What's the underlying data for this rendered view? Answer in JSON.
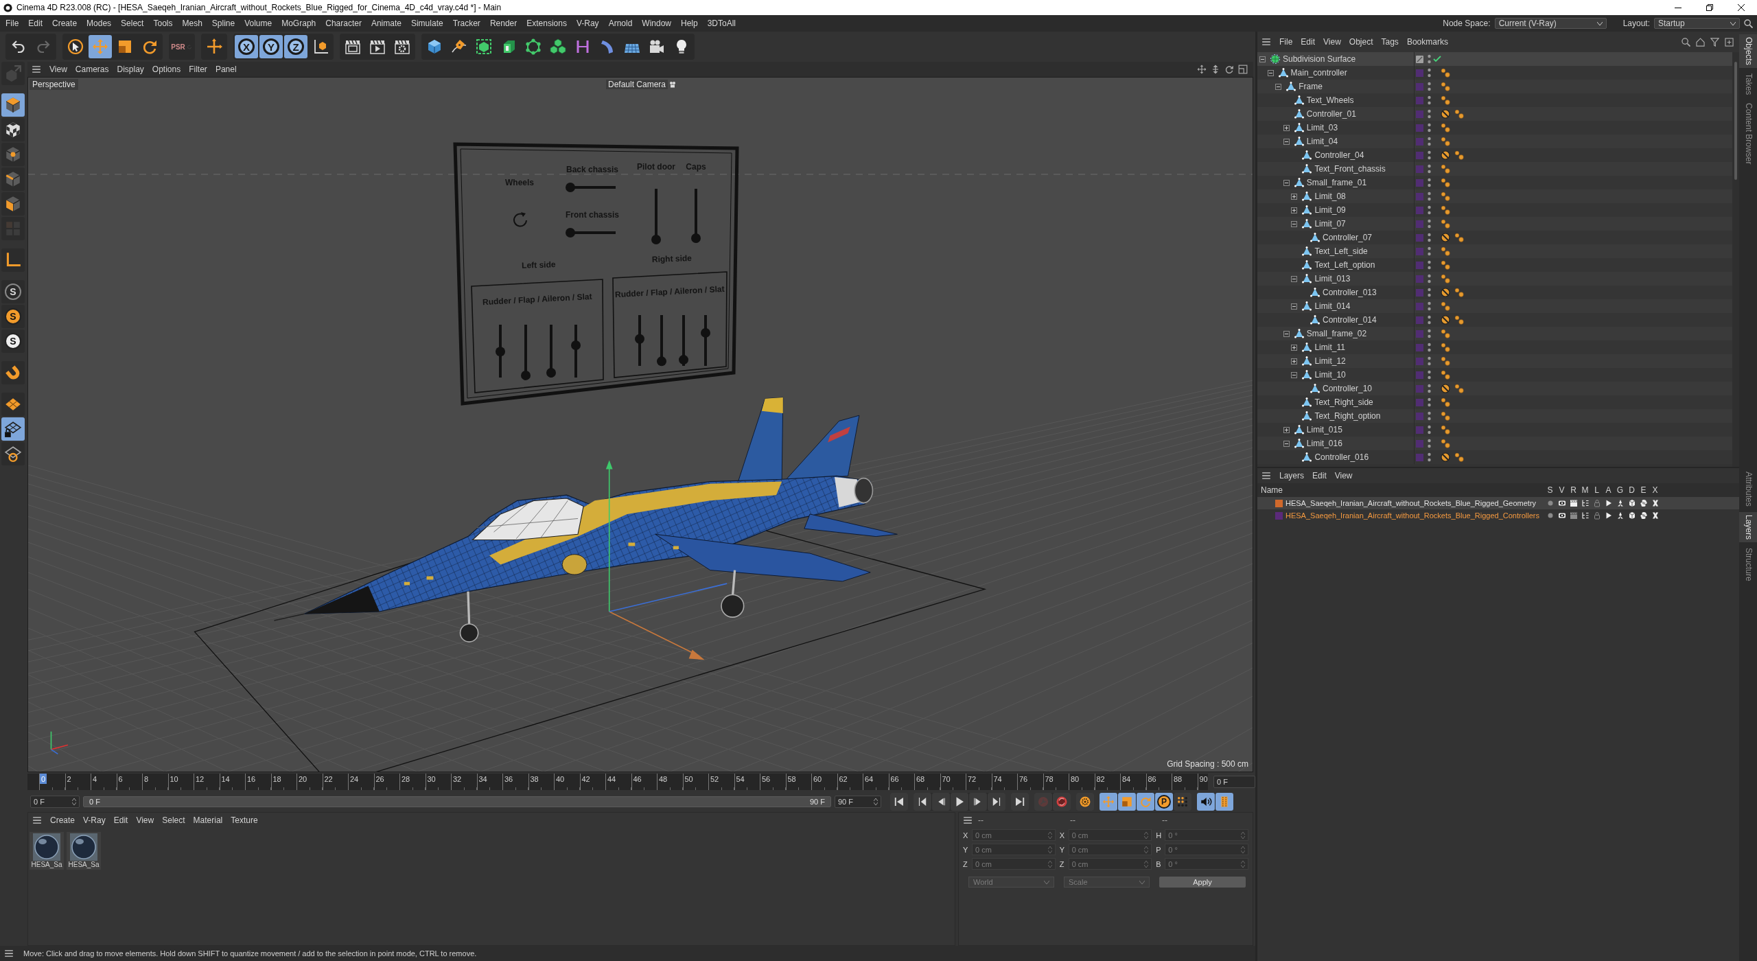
{
  "window": {
    "title": "Cinema 4D R23.008 (RC) - [HESA_Saeqeh_Iranian_Aircraft_without_Rockets_Blue_Rigged_for_Cinema_4D_c4d_vray.c4d *] - Main"
  },
  "menu_bar": {
    "items": [
      "File",
      "Edit",
      "Create",
      "Modes",
      "Select",
      "Tools",
      "Mesh",
      "Spline",
      "Volume",
      "MoGraph",
      "Character",
      "Animate",
      "Simulate",
      "Tracker",
      "Render",
      "Extensions",
      "V-Ray",
      "Arnold",
      "Window",
      "Help",
      "3DToAll"
    ],
    "node_space": {
      "label": "Node Space:",
      "value": "Current (V-Ray)"
    },
    "layout": {
      "label": "Layout:",
      "value": "Startup"
    }
  },
  "toolbar": {
    "groups": [
      [
        {
          "kind": "undo",
          "selected": false,
          "disabled": false
        },
        {
          "kind": "redo",
          "selected": false,
          "disabled": true
        }
      ],
      [
        {
          "kind": "select",
          "selected": false,
          "disabled": false
        },
        {
          "kind": "move",
          "selected": true,
          "disabled": false
        },
        {
          "kind": "scale",
          "selected": false,
          "disabled": false
        },
        {
          "kind": "rotate",
          "selected": false,
          "disabled": false
        }
      ],
      [
        {
          "kind": "psr",
          "label": "PSR",
          "selected": false,
          "disabled": true
        }
      ],
      [
        {
          "kind": "add",
          "selected": false,
          "disabled": false
        }
      ],
      [
        {
          "kind": "axis",
          "label": "X",
          "selected": true,
          "disabled": false
        },
        {
          "kind": "axis",
          "label": "Y",
          "selected": true,
          "disabled": false
        },
        {
          "kind": "axis",
          "label": "Z",
          "selected": true,
          "disabled": false
        },
        {
          "kind": "coords",
          "selected": false,
          "disabled": false
        }
      ],
      [
        {
          "kind": "render-view",
          "selected": false,
          "disabled": false
        },
        {
          "kind": "render",
          "selected": false,
          "disabled": false
        },
        {
          "kind": "render-settings",
          "selected": false,
          "disabled": false
        }
      ],
      [
        {
          "kind": "cube",
          "selected": false,
          "disabled": false
        },
        {
          "kind": "pen",
          "selected": false,
          "disabled": false
        },
        {
          "kind": "subdivision",
          "selected": false,
          "disabled": false
        },
        {
          "kind": "extrude",
          "selected": false,
          "disabled": false
        },
        {
          "kind": "polyhedron",
          "selected": false,
          "disabled": false
        },
        {
          "kind": "cloner",
          "selected": false,
          "disabled": false
        },
        {
          "kind": "symmetry",
          "selected": false,
          "disabled": false
        },
        {
          "kind": "deformer",
          "selected": false,
          "disabled": false
        },
        {
          "kind": "floor",
          "selected": false,
          "disabled": false
        },
        {
          "kind": "camera",
          "selected": false,
          "disabled": false
        },
        {
          "kind": "light",
          "selected": false,
          "disabled": false
        }
      ]
    ]
  },
  "left_toolbar": {
    "groups": [
      [
        {
          "kind": "make-editable",
          "selected": false,
          "disabled": true
        }
      ],
      [
        {
          "kind": "model",
          "selected": true,
          "disabled": false
        },
        {
          "kind": "texture",
          "selected": false,
          "disabled": false
        },
        {
          "kind": "point",
          "selected": false,
          "disabled": false
        },
        {
          "kind": "edge",
          "selected": false,
          "disabled": false
        },
        {
          "kind": "polygon",
          "selected": false,
          "disabled": false
        },
        {
          "kind": "uv",
          "selected": false,
          "disabled": true
        }
      ],
      [
        {
          "kind": "axis-mode",
          "selected": false,
          "disabled": false
        }
      ],
      [
        {
          "kind": "solo-off",
          "label": "S",
          "selected": false,
          "disabled": false
        },
        {
          "kind": "solo-single",
          "label": "S",
          "selected": false,
          "disabled": false
        },
        {
          "kind": "solo-hierarchy",
          "label": "S",
          "selected": false,
          "disabled": false
        }
      ],
      [
        {
          "kind": "magnet",
          "selected": false,
          "disabled": false
        }
      ],
      [
        {
          "kind": "workplane",
          "selected": false,
          "disabled": false
        },
        {
          "kind": "grid-lock",
          "selected": true,
          "disabled": false
        },
        {
          "kind": "grid-snap",
          "selected": false,
          "disabled": false
        }
      ]
    ]
  },
  "viewport": {
    "menu": [
      "View",
      "Cameras",
      "Display",
      "Options",
      "Filter",
      "Panel"
    ],
    "view_name": "Perspective",
    "camera": "Default Camera",
    "grid_spacing": "Grid Spacing : 500 cm",
    "board": {
      "wheels": "Wheels",
      "horizontal_sliders": [
        {
          "label": "Back chassis",
          "level": 0
        },
        {
          "label": "Front chassis",
          "level": 0
        }
      ],
      "vertical_sliders": [
        {
          "label": "Pilot door",
          "level": 0
        },
        {
          "label": "Caps",
          "level": 0
        }
      ],
      "sides": [
        {
          "label": "Left side",
          "group_title": "Rudder / Flap / Aileron / Slat",
          "sliders": [
            {
              "level": 0.49
            },
            {
              "level": 0.04
            },
            {
              "level": 0.09
            },
            {
              "level": 0.61
            }
          ]
        },
        {
          "label": "Right side",
          "group_title": "Rudder / Flap / Aileron / Slat",
          "sliders": [
            {
              "level": 0.53
            },
            {
              "level": 0.09
            },
            {
              "level": 0.12
            },
            {
              "level": 0.65
            }
          ]
        }
      ]
    }
  },
  "timeline": {
    "ticks": [
      {
        "label": "0",
        "selected": true
      },
      {
        "label": "2",
        "selected": false
      },
      {
        "label": "4",
        "selected": false
      },
      {
        "label": "6",
        "selected": false
      },
      {
        "label": "8",
        "selected": false
      },
      {
        "label": "10",
        "selected": false
      },
      {
        "label": "12",
        "selected": false
      },
      {
        "label": "14",
        "selected": false
      },
      {
        "label": "16",
        "selected": false
      },
      {
        "label": "18",
        "selected": false
      },
      {
        "label": "20",
        "selected": false
      },
      {
        "label": "22",
        "selected": false
      },
      {
        "label": "24",
        "selected": false
      },
      {
        "label": "26",
        "selected": false
      },
      {
        "label": "28",
        "selected": false
      },
      {
        "label": "30",
        "selected": false
      },
      {
        "label": "32",
        "selected": false
      },
      {
        "label": "34",
        "selected": false
      },
      {
        "label": "36",
        "selected": false
      },
      {
        "label": "38",
        "selected": false
      },
      {
        "label": "40",
        "selected": false
      },
      {
        "label": "42",
        "selected": false
      },
      {
        "label": "44",
        "selected": false
      },
      {
        "label": "46",
        "selected": false
      },
      {
        "label": "48",
        "selected": false
      },
      {
        "label": "50",
        "selected": false
      },
      {
        "label": "52",
        "selected": false
      },
      {
        "label": "54",
        "selected": false
      },
      {
        "label": "56",
        "selected": false
      },
      {
        "label": "58",
        "selected": false
      },
      {
        "label": "60",
        "selected": false
      },
      {
        "label": "62",
        "selected": false
      },
      {
        "label": "64",
        "selected": false
      },
      {
        "label": "66",
        "selected": false
      },
      {
        "label": "68",
        "selected": false
      },
      {
        "label": "70",
        "selected": false
      },
      {
        "label": "72",
        "selected": false
      },
      {
        "label": "74",
        "selected": false
      },
      {
        "label": "76",
        "selected": false
      },
      {
        "label": "78",
        "selected": false
      },
      {
        "label": "80",
        "selected": false
      },
      {
        "label": "82",
        "selected": false
      },
      {
        "label": "84",
        "selected": false
      },
      {
        "label": "86",
        "selected": false
      },
      {
        "label": "88",
        "selected": false
      },
      {
        "label": "90",
        "selected": false
      }
    ],
    "current_frame": "0 F"
  },
  "transport": {
    "start": "0 F",
    "range": {
      "start": "0 F",
      "end": "90 F",
      "level": 1
    },
    "end": "90 F",
    "groups": [
      [
        {
          "kind": "first",
          "selected": false,
          "disabled": false
        }
      ],
      [
        {
          "kind": "prev-key",
          "selected": false,
          "disabled": false
        },
        {
          "kind": "prev-frame",
          "selected": false,
          "disabled": false
        },
        {
          "kind": "play",
          "selected": false,
          "disabled": false
        },
        {
          "kind": "next-frame",
          "selected": false,
          "disabled": false
        },
        {
          "kind": "next-key",
          "selected": false,
          "disabled": false
        }
      ],
      [
        {
          "kind": "last",
          "selected": false,
          "disabled": false
        }
      ],
      [
        {
          "kind": "record",
          "selected": false,
          "disabled": true
        },
        {
          "kind": "autokey",
          "selected": false,
          "disabled": false
        }
      ],
      [
        {
          "kind": "key",
          "selected": false,
          "disabled": false
        }
      ],
      [
        {
          "kind": "key-move",
          "selected": true,
          "disabled": false
        },
        {
          "kind": "key-scale",
          "selected": true,
          "disabled": false
        },
        {
          "kind": "key-rotate",
          "selected": true,
          "disabled": false
        },
        {
          "kind": "key-param",
          "label": "P",
          "selected": true,
          "disabled": false
        },
        {
          "kind": "key-pla",
          "selected": false,
          "disabled": false
        }
      ],
      [
        {
          "kind": "sound",
          "selected": true,
          "disabled": false
        },
        {
          "kind": "film",
          "selected": true,
          "disabled": false
        }
      ]
    ]
  },
  "materials": {
    "menu": [
      "Create",
      "V-Ray",
      "Edit",
      "View",
      "Select",
      "Material",
      "Texture"
    ],
    "items": [
      {
        "label": "HESA_Sa"
      },
      {
        "label": "HESA_Sa"
      }
    ]
  },
  "coordinates": {
    "headers": [
      "--",
      "--",
      "--"
    ],
    "rows": [
      [
        {
          "axis": "X",
          "value": "0 cm",
          "disabled": true
        },
        {
          "axis": "X",
          "value": "0 cm",
          "disabled": true
        },
        {
          "axis": "H",
          "value": "0 °",
          "disabled": true
        }
      ],
      [
        {
          "axis": "Y",
          "value": "0 cm",
          "disabled": true
        },
        {
          "axis": "Y",
          "value": "0 cm",
          "disabled": true
        },
        {
          "axis": "P",
          "value": "0 °",
          "disabled": true
        }
      ],
      [
        {
          "axis": "Z",
          "value": "0 cm",
          "disabled": true
        },
        {
          "axis": "Z",
          "value": "0 cm",
          "disabled": true
        },
        {
          "axis": "B",
          "value": "0 °",
          "disabled": true
        }
      ]
    ],
    "dropdowns": [
      {
        "value": "World",
        "disabled": true
      },
      {
        "value": "Scale",
        "disabled": true
      }
    ],
    "apply": "Apply"
  },
  "status_bar": {
    "text": "Move: Click and drag to move elements. Hold down SHIFT to quantize movement / add to the selection in point mode, CTRL to remove."
  },
  "objects": {
    "menu": [
      "File",
      "Edit",
      "View",
      "Object",
      "Tags",
      "Bookmarks"
    ],
    "items": [
      {
        "name": "Subdivision Surface",
        "kind": "generator",
        "expanded": true,
        "enabled": true,
        "children": [
          {
            "name": "Main_controller",
            "kind": "object",
            "expanded": true,
            "tags": [
              {
                "kind": "constraint"
              }
            ],
            "children": [
              {
                "name": "Frame",
                "kind": "object",
                "expanded": true,
                "tags": [
                  {
                    "kind": "constraint"
                  }
                ],
                "children": [
                  {
                    "name": "Text_Wheels",
                    "kind": "object",
                    "tags": [
                      {
                        "kind": "constraint"
                      }
                    ]
                  },
                  {
                    "name": "Controller_01",
                    "kind": "object",
                    "tags": [
                      {
                        "kind": "protection"
                      },
                      {
                        "kind": "constraint"
                      }
                    ]
                  },
                  {
                    "name": "Limit_03",
                    "kind": "object",
                    "expanded": false,
                    "tags": [
                      {
                        "kind": "constraint"
                      }
                    ]
                  },
                  {
                    "name": "Limit_04",
                    "kind": "object",
                    "expanded": true,
                    "tags": [
                      {
                        "kind": "constraint"
                      }
                    ],
                    "children": [
                      {
                        "name": "Controller_04",
                        "kind": "object",
                        "tags": [
                          {
                            "kind": "protection"
                          },
                          {
                            "kind": "constraint"
                          }
                        ]
                      },
                      {
                        "name": "Text_Front_chassis",
                        "kind": "object",
                        "tags": [
                          {
                            "kind": "constraint"
                          }
                        ]
                      }
                    ]
                  },
                  {
                    "name": "Small_frame_01",
                    "kind": "object",
                    "expanded": true,
                    "tags": [
                      {
                        "kind": "constraint"
                      }
                    ],
                    "children": [
                      {
                        "name": "Limit_08",
                        "kind": "object",
                        "expanded": false,
                        "tags": [
                          {
                            "kind": "constraint"
                          }
                        ]
                      },
                      {
                        "name": "Limit_09",
                        "kind": "object",
                        "expanded": false,
                        "tags": [
                          {
                            "kind": "constraint"
                          }
                        ]
                      },
                      {
                        "name": "Limit_07",
                        "kind": "object",
                        "expanded": true,
                        "tags": [
                          {
                            "kind": "constraint"
                          }
                        ],
                        "children": [
                          {
                            "name": "Controller_07",
                            "kind": "object",
                            "tags": [
                              {
                                "kind": "protection"
                              },
                              {
                                "kind": "constraint"
                              }
                            ]
                          }
                        ]
                      },
                      {
                        "name": "Text_Left_side",
                        "kind": "object",
                        "tags": [
                          {
                            "kind": "constraint"
                          }
                        ]
                      },
                      {
                        "name": "Text_Left_option",
                        "kind": "object",
                        "tags": [
                          {
                            "kind": "constraint"
                          }
                        ]
                      },
                      {
                        "name": "Limit_013",
                        "kind": "object",
                        "expanded": true,
                        "tags": [
                          {
                            "kind": "constraint"
                          }
                        ],
                        "children": [
                          {
                            "name": "Controller_013",
                            "kind": "object",
                            "tags": [
                              {
                                "kind": "protection"
                              },
                              {
                                "kind": "constraint"
                              }
                            ]
                          }
                        ]
                      },
                      {
                        "name": "Limit_014",
                        "kind": "object",
                        "expanded": true,
                        "tags": [
                          {
                            "kind": "constraint"
                          }
                        ],
                        "children": [
                          {
                            "name": "Controller_014",
                            "kind": "object",
                            "tags": [
                              {
                                "kind": "protection"
                              },
                              {
                                "kind": "constraint"
                              }
                            ]
                          }
                        ]
                      }
                    ]
                  },
                  {
                    "name": "Small_frame_02",
                    "kind": "object",
                    "expanded": true,
                    "tags": [
                      {
                        "kind": "constraint"
                      }
                    ],
                    "children": [
                      {
                        "name": "Limit_11",
                        "kind": "object",
                        "expanded": false,
                        "tags": [
                          {
                            "kind": "constraint"
                          }
                        ]
                      },
                      {
                        "name": "Limit_12",
                        "kind": "object",
                        "expanded": false,
                        "tags": [
                          {
                            "kind": "constraint"
                          }
                        ]
                      },
                      {
                        "name": "Limit_10",
                        "kind": "object",
                        "expanded": true,
                        "tags": [
                          {
                            "kind": "constraint"
                          }
                        ],
                        "children": [
                          {
                            "name": "Controller_10",
                            "kind": "object",
                            "tags": [
                              {
                                "kind": "protection"
                              },
                              {
                                "kind": "constraint"
                              }
                            ]
                          }
                        ]
                      },
                      {
                        "name": "Text_Right_side",
                        "kind": "object",
                        "tags": [
                          {
                            "kind": "constraint"
                          }
                        ]
                      },
                      {
                        "name": "Text_Right_option",
                        "kind": "object",
                        "tags": [
                          {
                            "kind": "constraint"
                          }
                        ]
                      }
                    ]
                  },
                  {
                    "name": "Limit_015",
                    "kind": "object",
                    "expanded": false,
                    "tags": [
                      {
                        "kind": "constraint"
                      }
                    ]
                  },
                  {
                    "name": "Limit_016",
                    "kind": "object",
                    "expanded": true,
                    "tags": [
                      {
                        "kind": "constraint"
                      }
                    ],
                    "children": [
                      {
                        "name": "Controller_016",
                        "kind": "object",
                        "tags": [
                          {
                            "kind": "protection"
                          },
                          {
                            "kind": "constraint"
                          }
                        ]
                      }
                    ]
                  }
                ]
              }
            ]
          }
        ]
      }
    ]
  },
  "layers": {
    "menu": [
      "Layers",
      "Edit",
      "View"
    ],
    "columns": [
      "Name",
      "S",
      "V",
      "R",
      "M",
      "L",
      "A",
      "G",
      "D",
      "E",
      "X"
    ],
    "rows": [
      {
        "name": "HESA_Saeqeh_Iranian_Aircraft_without_Rockets_Blue_Rigged_Geometry",
        "color": "#d0692c",
        "selected": true,
        "active": false,
        "switches": [
          false,
          true,
          true,
          true,
          false,
          true,
          true,
          true,
          true,
          true
        ]
      },
      {
        "name": "HESA_Saeqeh_Iranian_Aircraft_without_Rockets_Blue_Rigged_Controllers",
        "color": "#5b2a7a",
        "selected": false,
        "active": true,
        "switches": [
          false,
          true,
          false,
          true,
          false,
          true,
          true,
          true,
          true,
          true
        ]
      }
    ]
  },
  "side_tabs": {
    "top": [
      {
        "label": "Objects",
        "selected": true
      },
      {
        "label": "Takes",
        "selected": false
      },
      {
        "label": "Content Browser",
        "selected": false
      }
    ],
    "bottom": [
      {
        "label": "Attributes",
        "selected": false
      },
      {
        "label": "Layers",
        "selected": true
      },
      {
        "label": "Structure",
        "selected": false
      }
    ]
  }
}
